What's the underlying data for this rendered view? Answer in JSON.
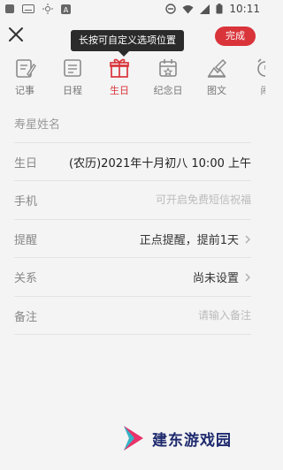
{
  "status_bar": {
    "time": "10:11"
  },
  "header": {
    "tooltip": "长按可自定义选项位置",
    "done_label": "完成"
  },
  "tabs": [
    {
      "label": "记事",
      "icon": "note-icon",
      "active": false
    },
    {
      "label": "日程",
      "icon": "schedule-icon",
      "active": false
    },
    {
      "label": "生日",
      "icon": "gift-icon",
      "active": true
    },
    {
      "label": "纪念日",
      "icon": "anniversary-calendar-icon",
      "active": false
    },
    {
      "label": "图文",
      "icon": "image-text-icon",
      "active": false
    },
    {
      "label": "闹",
      "icon": "alarm-icon",
      "active": false
    }
  ],
  "form": {
    "name": {
      "label": "寿星姓名"
    },
    "birthday": {
      "label": "生日",
      "value": "(农历)2021年十月初八 10:00 上午"
    },
    "phone": {
      "label": "手机",
      "placeholder": "可开启免费短信祝福"
    },
    "reminder": {
      "label": "提醒",
      "value": "正点提醒，提前1天"
    },
    "relation": {
      "label": "关系",
      "value": "尚未设置"
    },
    "note": {
      "label": "备注",
      "placeholder": "请输入备注"
    }
  },
  "watermark": {
    "text": "建东游戏园"
  },
  "colors": {
    "accent": "#d9343a",
    "background": "#f4f4f4",
    "divider": "#e3e3e3"
  }
}
